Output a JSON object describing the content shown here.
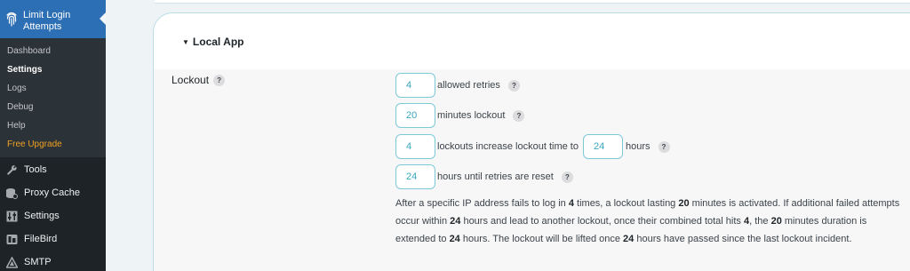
{
  "sidebar": {
    "plugin_title": "Limit Login Attempts",
    "submenu": [
      {
        "label": "Dashboard"
      },
      {
        "label": "Settings"
      },
      {
        "label": "Logs"
      },
      {
        "label": "Debug"
      },
      {
        "label": "Help"
      },
      {
        "label": "Free Upgrade"
      }
    ],
    "menu": [
      {
        "label": "Tools",
        "icon": "wrench-icon"
      },
      {
        "label": "Proxy Cache",
        "icon": "database-icon"
      },
      {
        "label": "Settings",
        "icon": "sliders-icon"
      },
      {
        "label": "FileBird",
        "icon": "folder-icon"
      },
      {
        "label": "SMTP",
        "icon": "triangle-icon"
      }
    ]
  },
  "section": {
    "title": "Local App"
  },
  "lockout": {
    "label": "Lockout",
    "help": "?",
    "allowed_retries": {
      "value": "4",
      "text": "allowed retries"
    },
    "minutes_lockout": {
      "value": "20",
      "text": "minutes lockout"
    },
    "lockouts_increase": {
      "value": "4",
      "text": "lockouts increase lockout time to",
      "hours_value": "24",
      "hours_text": "hours"
    },
    "reset": {
      "value": "24",
      "text": "hours until retries are reset"
    },
    "description": {
      "p1": "After a specific IP address fails to log in ",
      "v1": "4",
      "p2": " times, a lockout lasting ",
      "v2": "20",
      "p3": " minutes is activated. If additional failed attempts occur within ",
      "v3": "24",
      "p4": " hours and lead to another lockout, once their combined total hits ",
      "v4": "4",
      "p5": ", the ",
      "v5": "20",
      "p6": " minutes duration is extended to ",
      "v6": "24",
      "p7": " hours. The lockout will be lifted once ",
      "v7": "24",
      "p8": " hours have passed since the last lockout incident."
    }
  },
  "colors": {
    "sidebar_bg": "#1d2327",
    "active_bg": "#2d6fb5",
    "upgrade": "#f0a020",
    "field_border": "#7cc9d8",
    "field_text": "#3aa7c0"
  }
}
